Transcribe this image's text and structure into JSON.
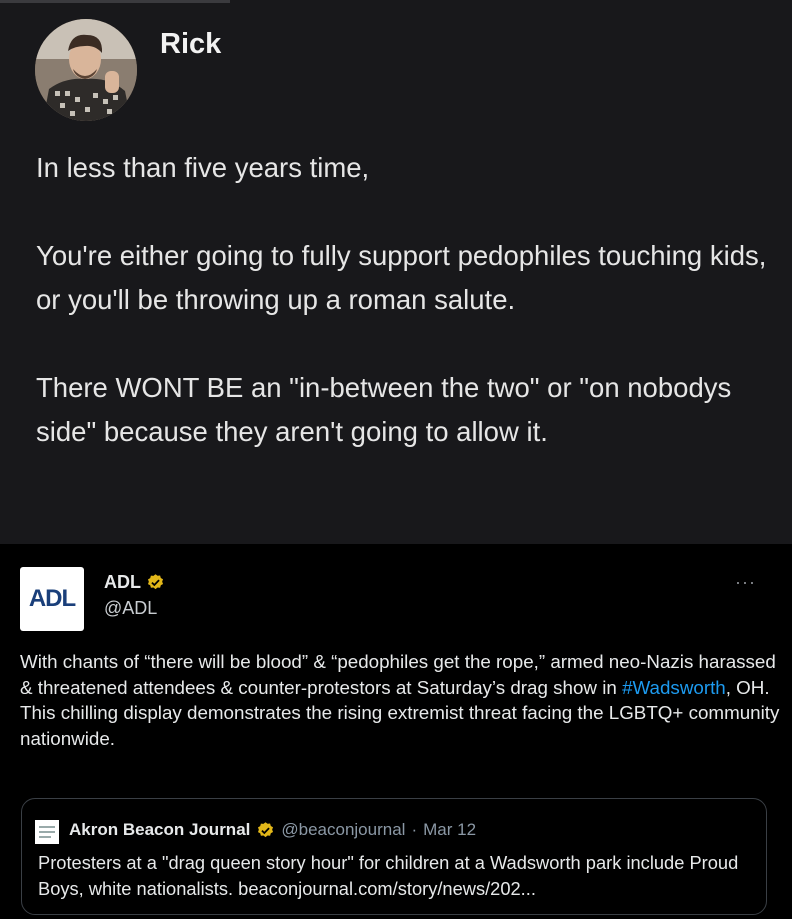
{
  "post1": {
    "author": "Rick",
    "paragraphs": [
      "In less than five years time,",
      "You're either going to fully support pedophiles touching kids, or you'll be throwing up a roman salute.",
      "There WONT BE an \"in-between the two\" or \"on nobodys side\" because they aren't going to allow it."
    ]
  },
  "post2": {
    "logo_text": "ADL",
    "author": "ADL",
    "handle": "@ADL",
    "more_label": "···",
    "body_before": "With chants of “there will be blood” & “pedophiles get the rope,” armed neo-Nazis harassed & threatened attendees & counter-protestors at Saturday’s drag show in ",
    "hashtag": "#Wadsworth",
    "body_after": ", OH. This chilling display demonstrates the rising extremist threat facing the LGBTQ+ community nationwide.",
    "verified_color": "#e2b719"
  },
  "quote": {
    "author": "Akron Beacon Journal",
    "handle": "@beaconjournal",
    "separator": "·",
    "date": "Mar 12",
    "text": "Protesters at a \"drag queen story hour\" for children at a Wadsworth park include Proud Boys, white nationalists. beaconjournal.com/story/news/202..."
  }
}
